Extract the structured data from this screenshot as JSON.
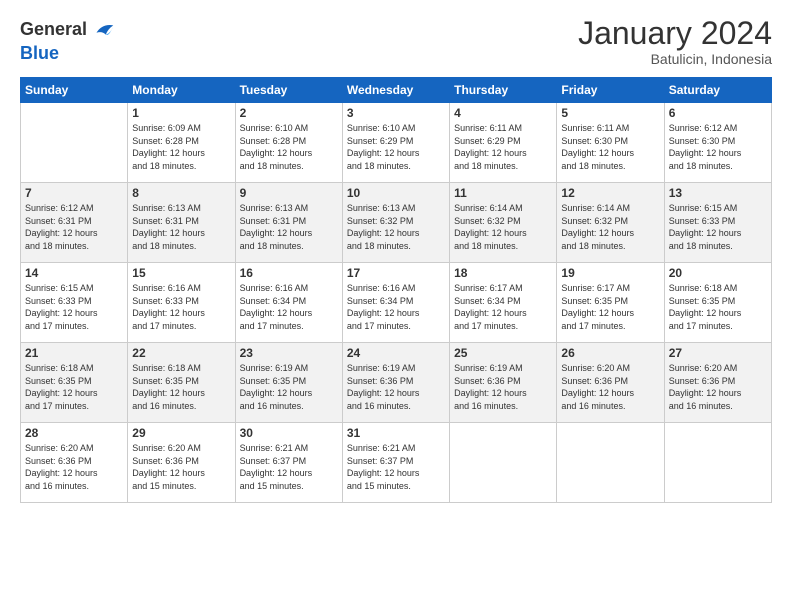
{
  "header": {
    "logo_general": "General",
    "logo_blue": "Blue",
    "month_title": "January 2024",
    "subtitle": "Batulicin, Indonesia"
  },
  "days_of_week": [
    "Sunday",
    "Monday",
    "Tuesday",
    "Wednesday",
    "Thursday",
    "Friday",
    "Saturday"
  ],
  "weeks": [
    [
      {
        "day": "",
        "info": ""
      },
      {
        "day": "1",
        "info": "Sunrise: 6:09 AM\nSunset: 6:28 PM\nDaylight: 12 hours\nand 18 minutes."
      },
      {
        "day": "2",
        "info": "Sunrise: 6:10 AM\nSunset: 6:28 PM\nDaylight: 12 hours\nand 18 minutes."
      },
      {
        "day": "3",
        "info": "Sunrise: 6:10 AM\nSunset: 6:29 PM\nDaylight: 12 hours\nand 18 minutes."
      },
      {
        "day": "4",
        "info": "Sunrise: 6:11 AM\nSunset: 6:29 PM\nDaylight: 12 hours\nand 18 minutes."
      },
      {
        "day": "5",
        "info": "Sunrise: 6:11 AM\nSunset: 6:30 PM\nDaylight: 12 hours\nand 18 minutes."
      },
      {
        "day": "6",
        "info": "Sunrise: 6:12 AM\nSunset: 6:30 PM\nDaylight: 12 hours\nand 18 minutes."
      }
    ],
    [
      {
        "day": "7",
        "info": "Sunrise: 6:12 AM\nSunset: 6:31 PM\nDaylight: 12 hours\nand 18 minutes."
      },
      {
        "day": "8",
        "info": "Sunrise: 6:13 AM\nSunset: 6:31 PM\nDaylight: 12 hours\nand 18 minutes."
      },
      {
        "day": "9",
        "info": "Sunrise: 6:13 AM\nSunset: 6:31 PM\nDaylight: 12 hours\nand 18 minutes."
      },
      {
        "day": "10",
        "info": "Sunrise: 6:13 AM\nSunset: 6:32 PM\nDaylight: 12 hours\nand 18 minutes."
      },
      {
        "day": "11",
        "info": "Sunrise: 6:14 AM\nSunset: 6:32 PM\nDaylight: 12 hours\nand 18 minutes."
      },
      {
        "day": "12",
        "info": "Sunrise: 6:14 AM\nSunset: 6:32 PM\nDaylight: 12 hours\nand 18 minutes."
      },
      {
        "day": "13",
        "info": "Sunrise: 6:15 AM\nSunset: 6:33 PM\nDaylight: 12 hours\nand 18 minutes."
      }
    ],
    [
      {
        "day": "14",
        "info": "Sunrise: 6:15 AM\nSunset: 6:33 PM\nDaylight: 12 hours\nand 17 minutes."
      },
      {
        "day": "15",
        "info": "Sunrise: 6:16 AM\nSunset: 6:33 PM\nDaylight: 12 hours\nand 17 minutes."
      },
      {
        "day": "16",
        "info": "Sunrise: 6:16 AM\nSunset: 6:34 PM\nDaylight: 12 hours\nand 17 minutes."
      },
      {
        "day": "17",
        "info": "Sunrise: 6:16 AM\nSunset: 6:34 PM\nDaylight: 12 hours\nand 17 minutes."
      },
      {
        "day": "18",
        "info": "Sunrise: 6:17 AM\nSunset: 6:34 PM\nDaylight: 12 hours\nand 17 minutes."
      },
      {
        "day": "19",
        "info": "Sunrise: 6:17 AM\nSunset: 6:35 PM\nDaylight: 12 hours\nand 17 minutes."
      },
      {
        "day": "20",
        "info": "Sunrise: 6:18 AM\nSunset: 6:35 PM\nDaylight: 12 hours\nand 17 minutes."
      }
    ],
    [
      {
        "day": "21",
        "info": "Sunrise: 6:18 AM\nSunset: 6:35 PM\nDaylight: 12 hours\nand 17 minutes."
      },
      {
        "day": "22",
        "info": "Sunrise: 6:18 AM\nSunset: 6:35 PM\nDaylight: 12 hours\nand 16 minutes."
      },
      {
        "day": "23",
        "info": "Sunrise: 6:19 AM\nSunset: 6:35 PM\nDaylight: 12 hours\nand 16 minutes."
      },
      {
        "day": "24",
        "info": "Sunrise: 6:19 AM\nSunset: 6:36 PM\nDaylight: 12 hours\nand 16 minutes."
      },
      {
        "day": "25",
        "info": "Sunrise: 6:19 AM\nSunset: 6:36 PM\nDaylight: 12 hours\nand 16 minutes."
      },
      {
        "day": "26",
        "info": "Sunrise: 6:20 AM\nSunset: 6:36 PM\nDaylight: 12 hours\nand 16 minutes."
      },
      {
        "day": "27",
        "info": "Sunrise: 6:20 AM\nSunset: 6:36 PM\nDaylight: 12 hours\nand 16 minutes."
      }
    ],
    [
      {
        "day": "28",
        "info": "Sunrise: 6:20 AM\nSunset: 6:36 PM\nDaylight: 12 hours\nand 16 minutes."
      },
      {
        "day": "29",
        "info": "Sunrise: 6:20 AM\nSunset: 6:36 PM\nDaylight: 12 hours\nand 15 minutes."
      },
      {
        "day": "30",
        "info": "Sunrise: 6:21 AM\nSunset: 6:37 PM\nDaylight: 12 hours\nand 15 minutes."
      },
      {
        "day": "31",
        "info": "Sunrise: 6:21 AM\nSunset: 6:37 PM\nDaylight: 12 hours\nand 15 minutes."
      },
      {
        "day": "",
        "info": ""
      },
      {
        "day": "",
        "info": ""
      },
      {
        "day": "",
        "info": ""
      }
    ]
  ]
}
